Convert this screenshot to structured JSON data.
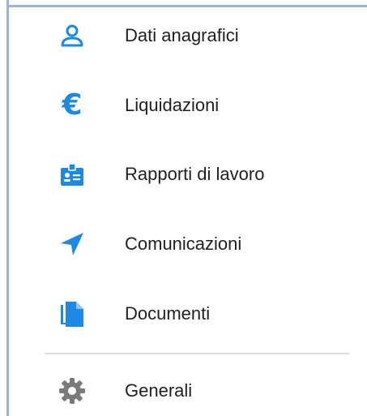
{
  "menu": {
    "items": [
      {
        "label": "Dati anagrafici",
        "icon": "person-icon",
        "color": "#1e88e5"
      },
      {
        "label": "Liquidazioni",
        "icon": "euro-icon",
        "color": "#1e88e5"
      },
      {
        "label": "Rapporti di lavoro",
        "icon": "badge-icon",
        "color": "#1e88e5"
      },
      {
        "label": "Comunicazioni",
        "icon": "send-icon",
        "color": "#1e88e5"
      },
      {
        "label": "Documenti",
        "icon": "documents-icon",
        "color": "#1e88e5"
      },
      {
        "label": "Generali",
        "icon": "gear-icon",
        "color": "#7a7a7a"
      }
    ],
    "euro_symbol": "€"
  }
}
